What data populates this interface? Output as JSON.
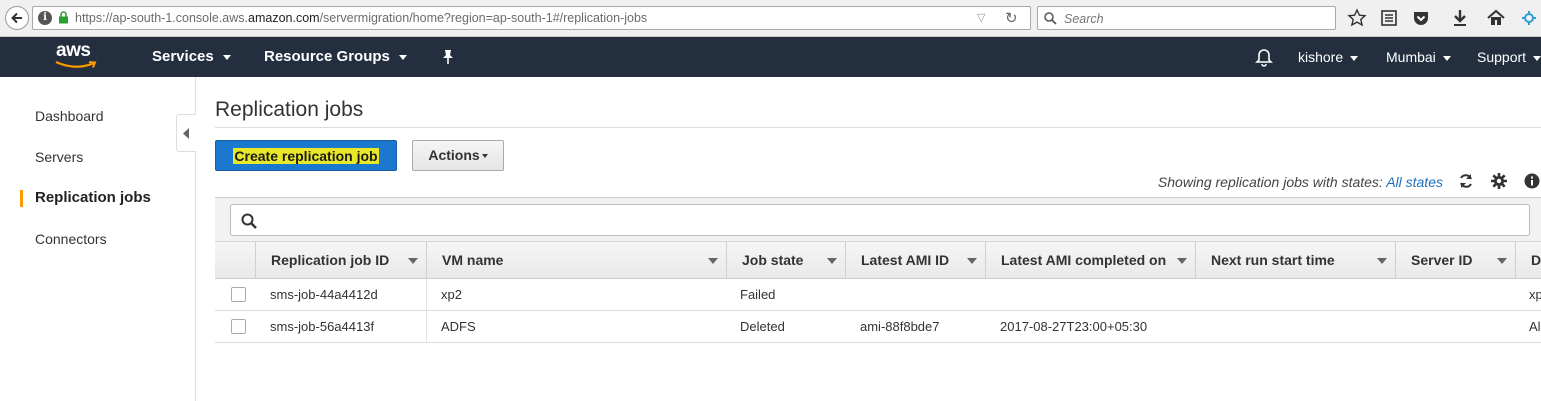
{
  "browser": {
    "url_prefix": "https://ap-south-1.console.aws.",
    "url_domain": "amazon.com",
    "url_suffix": "/servermigration/home?region=ap-south-1#/replication-jobs",
    "search_placeholder": "Search"
  },
  "header": {
    "logo_text": "aws",
    "services": "Services",
    "resource_groups": "Resource Groups",
    "user": "kishore",
    "region": "Mumbai",
    "support": "Support"
  },
  "sidebar": {
    "items": [
      {
        "label": "Dashboard"
      },
      {
        "label": "Servers"
      },
      {
        "label": "Replication jobs"
      },
      {
        "label": "Connectors"
      }
    ]
  },
  "main": {
    "title": "Replication jobs",
    "create_button": "Create replication job",
    "actions_button": "Actions",
    "showing_prefix": "Showing replication jobs with states: ",
    "showing_link": "All states"
  },
  "table": {
    "columns": [
      "Replication job ID",
      "VM name",
      "Job state",
      "Latest AMI ID",
      "Latest AMI completed on",
      "Next run start time",
      "Server ID",
      "D"
    ],
    "rows": [
      {
        "job_id": "sms-job-44a4412d",
        "vm_name": "xp2",
        "job_state": "Failed",
        "ami_id": "",
        "ami_completed": "",
        "next_run": "",
        "server_id": "",
        "extra": "xp"
      },
      {
        "job_id": "sms-job-56a4413f",
        "vm_name": "ADFS",
        "job_state": "Deleted",
        "ami_id": "ami-88f8bde7",
        "ami_completed": "2017-08-27T23:00+05:30",
        "next_run": "",
        "server_id": "",
        "extra": "Al"
      }
    ]
  },
  "colors": {
    "header_bg": "#232f3e",
    "primary_button": "#1a78cf",
    "active_marker": "#ff9900",
    "link": "#1f6fbd"
  }
}
